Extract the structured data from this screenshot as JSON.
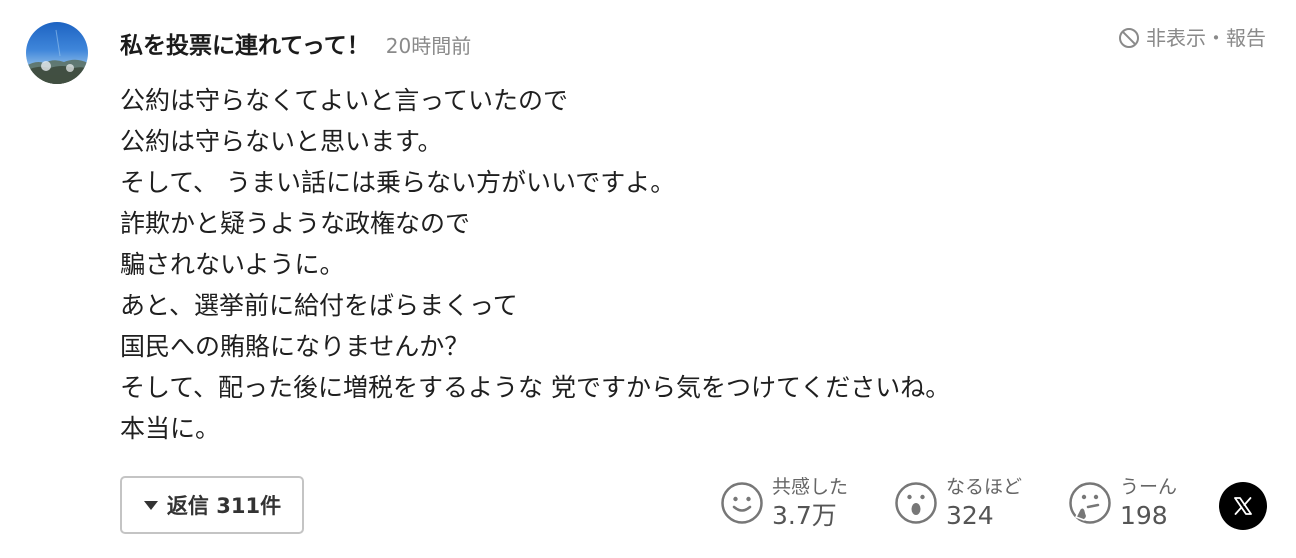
{
  "comment": {
    "username": "私を投票に連れてって！",
    "time": "20時間前",
    "hide_report_label": "非表示・報告",
    "lines": [
      "公約は守らなくてよいと言っていたので",
      "公約は守らないと思います。",
      "そして、 うまい話には乗らない方がいいですよ。",
      "詐欺かと疑うような政権なので",
      "騙されないように。",
      "あと、選挙前に給付をばらまくって",
      "国民への賄賂になりませんか？",
      "そして、配った後に増税をするような 党ですから気をつけてくださいね。",
      "本当に。"
    ]
  },
  "replies": {
    "label": "返信 311件"
  },
  "reactions": [
    {
      "label": "共感した",
      "count": "3.7万",
      "icon": "smile-face-icon"
    },
    {
      "label": "なるほど",
      "count": "324",
      "icon": "surprised-face-icon"
    },
    {
      "label": "うーん",
      "count": "198",
      "icon": "thinking-face-icon"
    }
  ],
  "share": {
    "icon": "x-logo-icon"
  },
  "colors": {
    "text": "#1f1f1f",
    "muted": "#8a8a8a",
    "border": "#c4c4c4",
    "x_bg": "#000000"
  }
}
